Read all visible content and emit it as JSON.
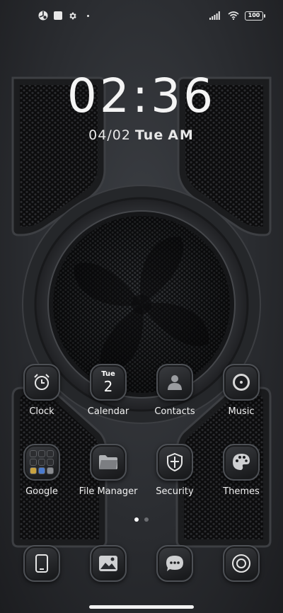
{
  "status_bar": {
    "battery_level": "100",
    "left_icons": [
      "app-notification-icon",
      "square-notification-icon",
      "settings-icon",
      "dot-icon"
    ],
    "right_icons": [
      "signal-icon",
      "wifi-icon",
      "battery-icon"
    ]
  },
  "clock_widget": {
    "time": "02:36",
    "date": "04/02",
    "weekday": "Tue",
    "ampm": "AM"
  },
  "apps": [
    {
      "label": "Clock",
      "icon": "alarm-clock-icon"
    },
    {
      "label": "Calendar",
      "icon": "calendar-icon",
      "calendar_day": "Tue",
      "calendar_date": "2"
    },
    {
      "label": "Contacts",
      "icon": "person-icon"
    },
    {
      "label": "Music",
      "icon": "music-disc-icon"
    },
    {
      "label": "Google",
      "icon": "google-folder-icon"
    },
    {
      "label": "File Manager",
      "icon": "folder-icon"
    },
    {
      "label": "Security",
      "icon": "shield-icon"
    },
    {
      "label": "Themes",
      "icon": "palette-icon"
    }
  ],
  "dock": [
    {
      "icon": "phone-icon"
    },
    {
      "icon": "gallery-icon"
    },
    {
      "icon": "messaging-icon"
    },
    {
      "icon": "camera-icon"
    }
  ],
  "page_indicator": {
    "count": 2,
    "active": 1
  },
  "colors": {
    "background": "#2a2c30",
    "text": "#ffffff",
    "icon_border": "#4d5055"
  }
}
